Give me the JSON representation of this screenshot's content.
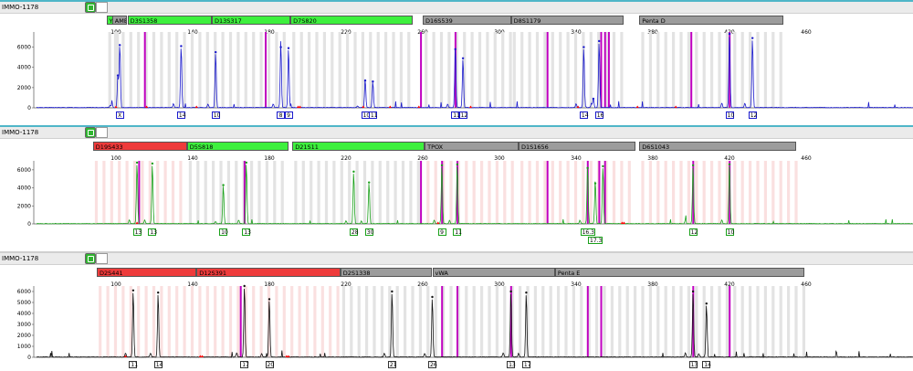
{
  "colors": {
    "separator": "#4fb6c8",
    "marker_green": "#3ef03e",
    "marker_gray": "#9c9c9c",
    "marker_red": "#ee3b3b",
    "bin_gray": "#e3e3e3",
    "bin_pink": "#fae0e0",
    "dye_blue": "#1a1acc",
    "dye_green": "#1aa01a",
    "dye_black": "#111111",
    "pull_up_magenta": "#c000c0",
    "ladder_red": "#ff0000"
  },
  "panels": [
    {
      "sample_name": "IMMO-1178",
      "header_button_icon": "green-marker-icon",
      "dye": "blue",
      "x_axis_ticks": [
        100,
        140,
        180,
        220,
        260,
        300,
        340,
        380,
        420,
        460
      ],
      "y_axis_ticks": [
        0,
        2000,
        4000,
        6000
      ],
      "y_max": 7500,
      "markers": [
        {
          "label": "Yin...",
          "color": "green",
          "start": 95,
          "end": 103
        },
        {
          "label": "AMEL",
          "color": "gray",
          "start": 98,
          "end": 105
        },
        {
          "label": "D3S1358",
          "color": "green",
          "start": 106,
          "end": 150
        },
        {
          "label": "D13S317",
          "color": "green",
          "start": 150,
          "end": 191
        },
        {
          "label": "D7S820",
          "color": "green",
          "start": 191,
          "end": 255
        },
        {
          "label": "D16S539",
          "color": "gray",
          "start": 260,
          "end": 306
        },
        {
          "label": "D8S1179",
          "color": "gray",
          "start": 306,
          "end": 365
        },
        {
          "label": "Penta D",
          "color": "gray",
          "start": 373,
          "end": 448
        }
      ],
      "peaks": [
        {
          "pos": 102,
          "height": 6200
        },
        {
          "pos": 101,
          "height": 3200
        },
        {
          "pos": 134,
          "height": 6100
        },
        {
          "pos": 152,
          "height": 5500
        },
        {
          "pos": 186,
          "height": 6000
        },
        {
          "pos": 190,
          "height": 5900
        },
        {
          "pos": 230,
          "height": 2700
        },
        {
          "pos": 234,
          "height": 2600
        },
        {
          "pos": 277,
          "height": 5800
        },
        {
          "pos": 281,
          "height": 4900
        },
        {
          "pos": 344,
          "height": 6000
        },
        {
          "pos": 349,
          "height": 900
        },
        {
          "pos": 352,
          "height": 6600
        },
        {
          "pos": 420,
          "height": 7300
        },
        {
          "pos": 432,
          "height": 6900
        }
      ],
      "pull_up_lines": [
        115,
        178,
        259,
        277,
        325,
        353,
        355,
        357,
        400,
        420
      ],
      "ladder_marks": [
        100,
        116,
        142,
        195,
        196,
        229,
        243,
        258,
        285,
        341,
        372,
        392
      ],
      "alleles": [
        {
          "label": "X",
          "pos": 102
        },
        {
          "label": "14",
          "pos": 134
        },
        {
          "label": "10",
          "pos": 152
        },
        {
          "label": "8",
          "pos": 186
        },
        {
          "label": "9",
          "pos": 190
        },
        {
          "label": "10",
          "pos": 230
        },
        {
          "label": "11",
          "pos": 234
        },
        {
          "label": "11",
          "pos": 277
        },
        {
          "label": "12",
          "pos": 281
        },
        {
          "label": "14",
          "pos": 344
        },
        {
          "label": "16",
          "pos": 352
        },
        {
          "label": "10",
          "pos": 420
        },
        {
          "label": "12",
          "pos": 432
        }
      ]
    },
    {
      "sample_name": "IMMO-1178",
      "header_button_icon": "green-marker-icon",
      "dye": "green",
      "x_axis_ticks": [
        100,
        140,
        180,
        220,
        260,
        300,
        340,
        380,
        420,
        460
      ],
      "y_axis_ticks": [
        0,
        2000,
        4000,
        6000
      ],
      "y_max": 7000,
      "markers": [
        {
          "label": "D19S433",
          "color": "red",
          "start": 88,
          "end": 137
        },
        {
          "label": "D5S818",
          "color": "green",
          "start": 137,
          "end": 190
        },
        {
          "label": "D21S11",
          "color": "green",
          "start": 192,
          "end": 261
        },
        {
          "label": "TPOX",
          "color": "gray",
          "start": 261,
          "end": 310
        },
        {
          "label": "D1S1656",
          "color": "gray",
          "start": 310,
          "end": 371
        },
        {
          "label": "D6S1043",
          "color": "gray",
          "start": 373,
          "end": 455
        }
      ],
      "peaks": [
        {
          "pos": 111,
          "height": 6800
        },
        {
          "pos": 119,
          "height": 6700
        },
        {
          "pos": 156,
          "height": 4300
        },
        {
          "pos": 168,
          "height": 6800
        },
        {
          "pos": 224,
          "height": 5800
        },
        {
          "pos": 232,
          "height": 4600
        },
        {
          "pos": 270,
          "height": 6500
        },
        {
          "pos": 278,
          "height": 6600
        },
        {
          "pos": 346,
          "height": 6200
        },
        {
          "pos": 350,
          "height": 4500
        },
        {
          "pos": 354,
          "height": 6400
        },
        {
          "pos": 401,
          "height": 6500
        },
        {
          "pos": 420,
          "height": 6600
        }
      ],
      "pull_up_lines": [
        112,
        167,
        259,
        270,
        278,
        325,
        346,
        352,
        355,
        401,
        420
      ],
      "ladder_marks": [
        111,
        268,
        364,
        365
      ],
      "alleles": [
        {
          "label": "13",
          "pos": 111
        },
        {
          "label": "13",
          "pos": 119
        },
        {
          "label": "10",
          "pos": 156
        },
        {
          "label": "13",
          "pos": 168
        },
        {
          "label": "28",
          "pos": 224
        },
        {
          "label": "30",
          "pos": 232
        },
        {
          "label": "9",
          "pos": 270
        },
        {
          "label": "11",
          "pos": 278
        },
        {
          "label": "16.3",
          "pos": 346
        },
        {
          "label": "17.3",
          "pos": 350,
          "row": 2
        },
        {
          "label": "12",
          "pos": 401
        },
        {
          "label": "10",
          "pos": 420
        }
      ]
    },
    {
      "sample_name": "IMMO-1178",
      "header_button_icon": "green-marker-icon",
      "dye": "black",
      "x_axis_ticks": [
        100,
        140,
        180,
        220,
        260,
        300,
        340,
        380,
        420,
        460
      ],
      "y_axis_ticks": [
        0,
        1000,
        2000,
        3000,
        4000,
        5000,
        6000
      ],
      "y_max": 6500,
      "markers": [
        {
          "label": "D2S441",
          "color": "red",
          "start": 90,
          "end": 142
        },
        {
          "label": "D12S391",
          "color": "red",
          "start": 142,
          "end": 217
        },
        {
          "label": "D2S1338",
          "color": "gray",
          "start": 217,
          "end": 265
        },
        {
          "label": "vWA",
          "color": "gray",
          "start": 265,
          "end": 329
        },
        {
          "label": "Penta E",
          "color": "gray",
          "start": 329,
          "end": 459
        }
      ],
      "peaks": [
        {
          "pos": 109,
          "height": 6100
        },
        {
          "pos": 122,
          "height": 5900
        },
        {
          "pos": 167,
          "height": 6500
        },
        {
          "pos": 180,
          "height": 5300
        },
        {
          "pos": 244,
          "height": 6000
        },
        {
          "pos": 265,
          "height": 5500
        },
        {
          "pos": 306,
          "height": 6000
        },
        {
          "pos": 314,
          "height": 5900
        },
        {
          "pos": 401,
          "height": 6000
        },
        {
          "pos": 408,
          "height": 4900
        }
      ],
      "pull_up_lines": [
        165,
        270,
        278,
        306,
        346,
        353,
        401,
        420
      ],
      "ladder_marks": [
        105,
        144,
        145,
        189,
        190
      ],
      "alleles": [
        {
          "label": "11",
          "pos": 109
        },
        {
          "label": "14",
          "pos": 122
        },
        {
          "label": "17",
          "pos": 167
        },
        {
          "label": "20",
          "pos": 180
        },
        {
          "label": "21",
          "pos": 244
        },
        {
          "label": "26",
          "pos": 265
        },
        {
          "label": "13",
          "pos": 306
        },
        {
          "label": "17",
          "pos": 314
        },
        {
          "label": "13",
          "pos": 401
        },
        {
          "label": "14",
          "pos": 408
        }
      ]
    }
  ]
}
